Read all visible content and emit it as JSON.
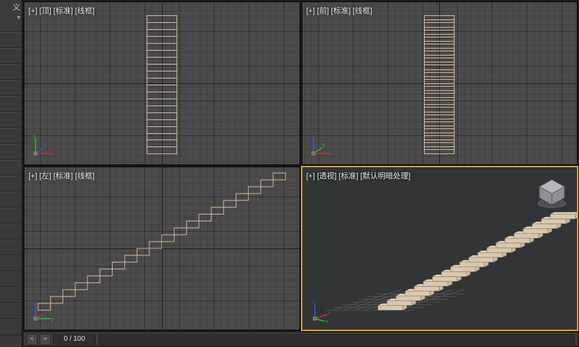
{
  "sidebar": {
    "title": "义",
    "dropdown_indicator": "▾"
  },
  "viewports": {
    "top": {
      "label": "[+] [顶] [标准] [线框]"
    },
    "front": {
      "label": "[+] [前] [标准] [线框]"
    },
    "left": {
      "label": "[+] [左] [标准] [线框]"
    },
    "persp": {
      "label": "[+] [透视] [标准] [默认明暗处理]"
    }
  },
  "timeline": {
    "prev": "<",
    "next": ">",
    "frame_display": "0 / 100"
  },
  "gizmo_axes": {
    "x": "x",
    "y": "y",
    "z": "z"
  },
  "model": {
    "steps": 20
  }
}
